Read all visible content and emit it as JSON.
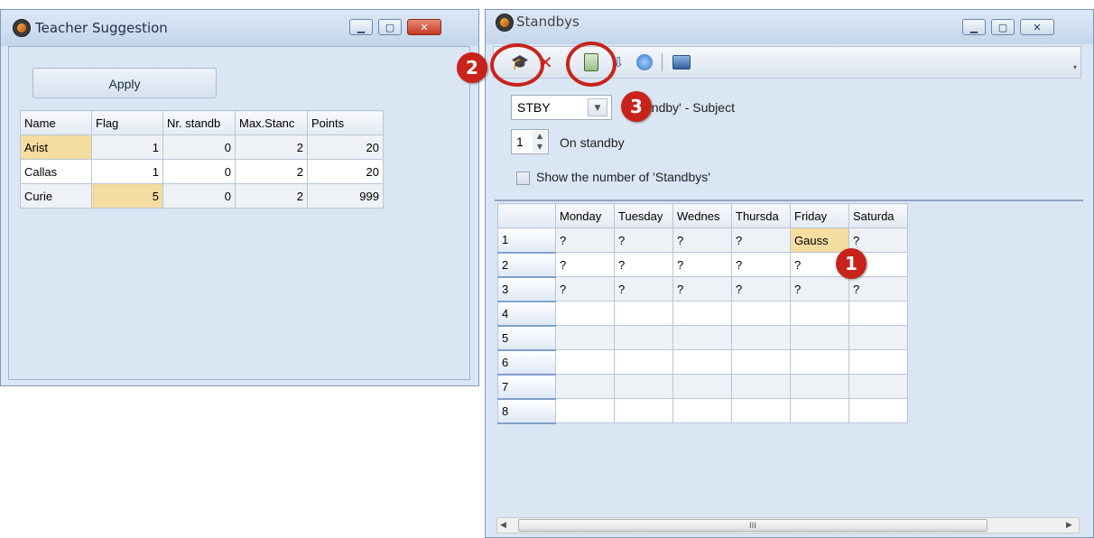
{
  "teacher_window": {
    "title": "Teacher Suggestion",
    "apply_label": "Apply",
    "columns": [
      "Name",
      "Flag",
      "Nr. standb",
      "Max.Stanc",
      "Points"
    ],
    "rows": [
      [
        "Arist",
        "1",
        "0",
        "2",
        "20"
      ],
      [
        "Callas",
        "1",
        "0",
        "2",
        "20"
      ],
      [
        "Curie",
        "5",
        "0",
        "2",
        "999"
      ]
    ]
  },
  "standby_window": {
    "title": "Standbys",
    "toolbar_icons": [
      "teacher-hat-icon",
      "delete-icon",
      "calculator-icon",
      "export-icon",
      "refresh-icon",
      "camera-icon"
    ],
    "subject_value": "STBY",
    "subject_label": "andby' - Subject",
    "count_value": "1",
    "count_label": "On standby",
    "show_number_label": "Show the number of 'Standbys'",
    "columns": [
      "",
      "Monday",
      "Tuesday",
      "Wednes",
      "Thursda",
      "Friday",
      "Saturda"
    ],
    "rows": [
      [
        "1",
        "?",
        "?",
        "?",
        "?",
        "Gauss",
        "?"
      ],
      [
        "2",
        "?",
        "?",
        "?",
        "?",
        "?",
        ""
      ],
      [
        "3",
        "?",
        "?",
        "?",
        "?",
        "?",
        "?"
      ],
      [
        "4",
        "",
        "",
        "",
        "",
        "",
        ""
      ],
      [
        "5",
        "",
        "",
        "",
        "",
        "",
        ""
      ],
      [
        "6",
        "",
        "",
        "",
        "",
        "",
        ""
      ],
      [
        "7",
        "",
        "",
        "",
        "",
        "",
        ""
      ],
      [
        "8",
        "",
        "",
        "",
        "",
        "",
        ""
      ]
    ],
    "scroll_thumb": "III"
  },
  "callouts": [
    "1",
    "2",
    "3"
  ],
  "colors": {
    "callout": "#c8231a",
    "highlight": "#f5dca0",
    "window": "#dbe6f4"
  }
}
